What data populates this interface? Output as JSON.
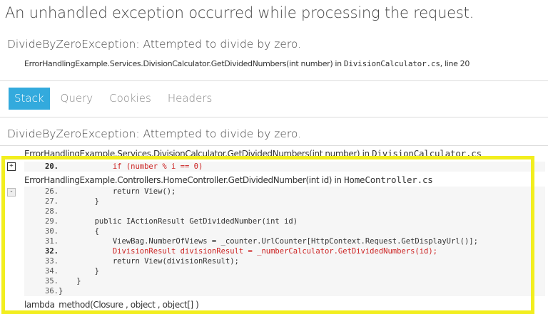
{
  "page_title": "An unhandled exception occurred while processing the request.",
  "exception": {
    "summary": "DivideByZeroException: Attempted to divide by zero.",
    "location_prefix": "ErrorHandlingExample.Services.DivisionCalculator.GetDividedNumbers(int number) in ",
    "location_file": "DivisionCalculator.cs",
    "location_suffix": ", line 20"
  },
  "tabs": [
    {
      "label": "Stack",
      "active": true
    },
    {
      "label": "Query",
      "active": false
    },
    {
      "label": "Cookies",
      "active": false
    },
    {
      "label": "Headers",
      "active": false
    }
  ],
  "stack": {
    "heading": "DivideByZeroException: Attempted to divide by zero.",
    "frame1": {
      "method": "ErrorHandlingExample.Services.DivisionCalculator.GetDividedNumbers(int number) in ",
      "file": "DivisionCalculator.cs",
      "toggle": "+",
      "line_no": "20.",
      "line_code": "            if (number % i == 0)"
    },
    "frame2": {
      "method": "ErrorHandlingExample.Controllers.HomeController.GetDividedNumber(int id) in ",
      "file": "HomeController.cs",
      "toggle": "-",
      "lines": [
        {
          "no": "26.",
          "code": "            return View();"
        },
        {
          "no": "27.",
          "code": "        }"
        },
        {
          "no": "28.",
          "code": ""
        },
        {
          "no": "29.",
          "code": "        public IActionResult GetDividedNumber(int id)"
        },
        {
          "no": "30.",
          "code": "        {"
        },
        {
          "no": "31.",
          "code": "            ViewBag.NumberOfViews = _counter.UrlCounter[HttpContext.Request.GetDisplayUrl()];"
        },
        {
          "no": "32.",
          "code": "            DivisionResult divisionResult = _numberCalculator.GetDividedNumbers(id);"
        },
        {
          "no": "33.",
          "code": "            return View(divisionResult);"
        },
        {
          "no": "34.",
          "code": "        }"
        },
        {
          "no": "35.",
          "code": "    }"
        },
        {
          "no": "36.",
          "code": "}"
        }
      ]
    },
    "frame3": {
      "method": "lambda_method(Closure , object , object[] )"
    }
  },
  "colors": {
    "accent": "#33aadd",
    "error_line": "#cc2222",
    "highlight": "#f2ee1e"
  }
}
